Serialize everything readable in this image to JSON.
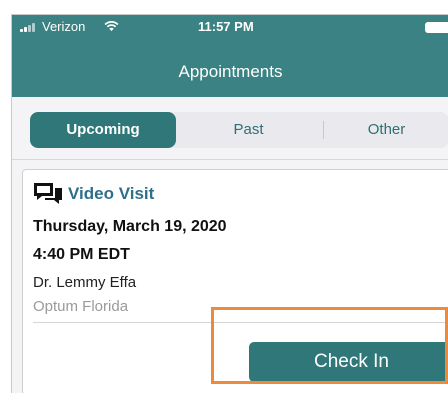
{
  "status_bar": {
    "carrier": "Verizon",
    "time": "11:57 PM"
  },
  "header": {
    "title": "Appointments"
  },
  "tabs": [
    {
      "label": "Upcoming",
      "active": true
    },
    {
      "label": "Past",
      "active": false
    },
    {
      "label": "Other",
      "active": false
    }
  ],
  "appointment": {
    "type": "Video Visit",
    "date": "Thursday, March 19, 2020",
    "time": "4:40 PM EDT",
    "provider": "Dr. Lemmy Effa",
    "location": "Optum Florida",
    "action_label": "Check In"
  },
  "colors": {
    "header_bg": "#3a8283",
    "accent": "#2f7779",
    "highlight": "#ee8a3b"
  }
}
